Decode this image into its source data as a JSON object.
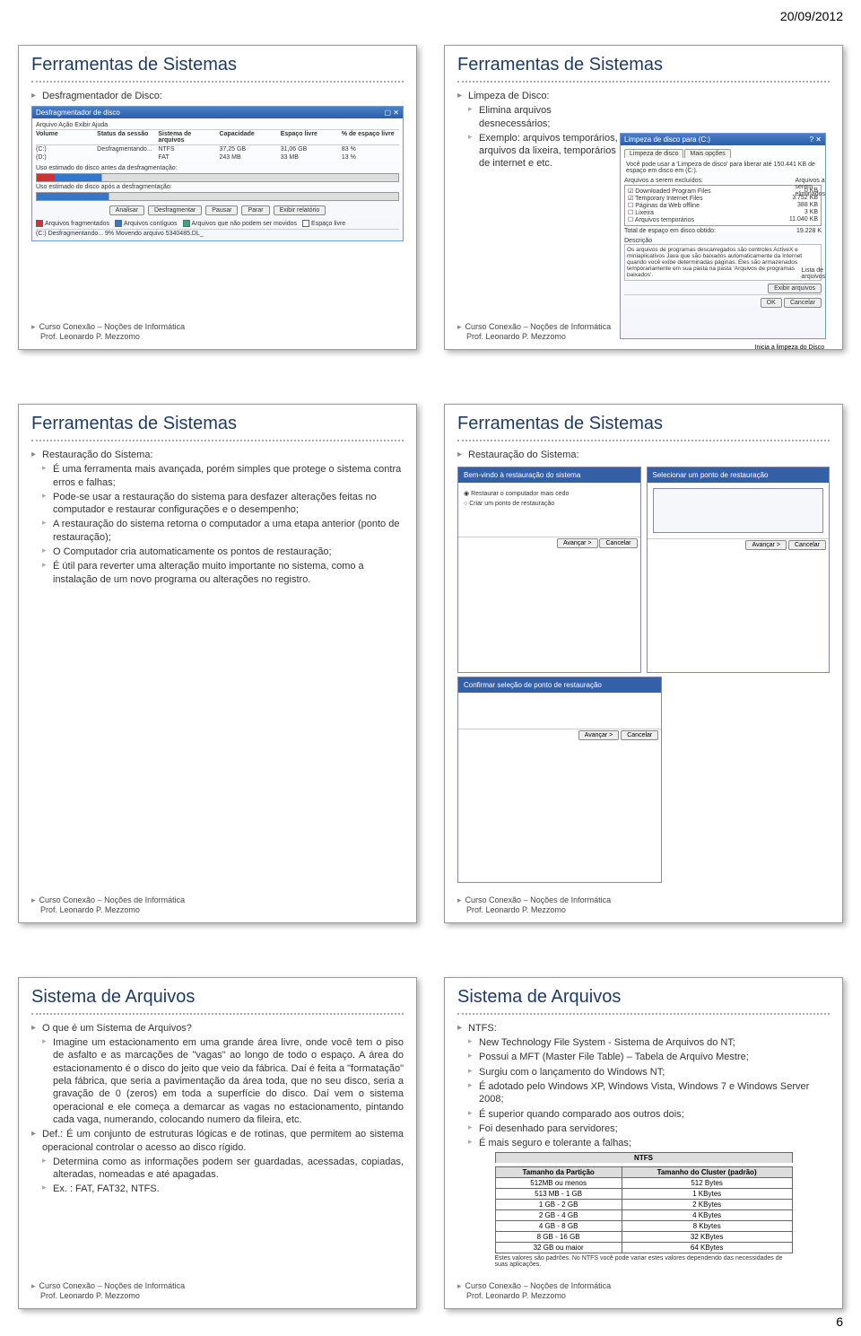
{
  "page": {
    "date": "20/09/2012",
    "number": "6"
  },
  "credit": {
    "line1": "Curso Conexão – Noções de Informática",
    "line2": "Prof. Leonardo P. Mezzomo"
  },
  "slides": {
    "s1": {
      "title": "Ferramentas de Sistemas",
      "b1": "Desfragmentador de Disco:",
      "defrag": {
        "win_title": "Desfragmentador de disco",
        "menu": "Arquivo   Ação   Exibir   Ajuda",
        "h_vol": "Volume",
        "h_status": "Status da sessão",
        "h_fs": "Sistema de arquivos",
        "h_cap": "Capacidade",
        "h_free": "Espaço livre",
        "h_pfree": "% de espaço livre",
        "r1_vol": "(C:)",
        "r1_status": "Desfragmentando...",
        "r1_fs": "NTFS",
        "r1_cap": "37,25 GB",
        "r1_free": "31,06 GB",
        "r1_pfree": "83 %",
        "r2_vol": "(D:)",
        "r2_fs": "FAT",
        "r2_cap": "243 MB",
        "r2_free": "33 MB",
        "r2_pfree": "13 %",
        "lbl_before": "Uso estimado do disco antes da desfragmentação:",
        "lbl_after": "Uso estimado do disco após a desfragmentação:",
        "btn_analyze": "Analisar",
        "btn_defrag": "Desfragmentar",
        "btn_pause": "Pausar",
        "btn_stop": "Parar",
        "btn_report": "Exibir relatório",
        "leg_frag": "Arquivos fragmentados",
        "leg_cont": "Arquivos contíguos",
        "leg_unmov": "Arquivos que não podem ser movidos",
        "leg_free": "Espaço livre",
        "status": "(C:) Desfragmentando... 9% Movendo arquivo 5340485.DL_"
      }
    },
    "s2": {
      "title": "Ferramentas de Sistemas",
      "b1": "Limpeza de Disco:",
      "b1a": "Elimina arquivos desnecessários;",
      "b1b": "Exemplo: arquivos temporários, arquivos da lixeira, temporários de internet e etc.",
      "clean": {
        "win_title": "Limpeza de disco para (C:)",
        "tab1": "Limpeza de disco",
        "tab2": "Mais opções",
        "intro": "Você pode usar a 'Limpeza de disco' para liberar até 150.441 KB de espaço em disco em (C:).",
        "lbl_files": "Arquivos a serem excluídos:",
        "i1": "Downloaded Program Files",
        "i1v": "0 KB",
        "i2": "Temporary Internet Files",
        "i2v": "3.752 KB",
        "i3": "Páginas da Web offline",
        "i3v": "388 KB",
        "i4": "Lixeira",
        "i4v": "3 KB",
        "i5": "Arquivos temporários",
        "i5v": "11.040 KB",
        "lbl_total": "Total de espaço em disco obtido:",
        "totalv": "19.228 K",
        "lbl_desc": "Descrição",
        "desc": "Os arquivos de programas descarregados são controles ActiveX e miniaplicativos Java que são baixados automaticamente da Internet quando você exibe determinadas páginas. Eles são armazenados temporariamente em sua pasta na pasta 'Arquivos de programas baixados'.",
        "btn_view": "Exibir arquivos",
        "btn_ok": "OK",
        "btn_cancel": "Cancelar",
        "annot1a": "Arquivos a",
        "annot1b": "serem",
        "annot1c": "eliminados",
        "annot2a": "Lista de",
        "annot2b": "arquivos",
        "footnote": "Inicia a limpeza do Disco"
      }
    },
    "s3": {
      "title": "Ferramentas de Sistemas",
      "b1": "Restauração do Sistema:",
      "b1a": "É uma ferramenta mais avançada, porém simples que protege o sistema contra erros e falhas;",
      "b1b": "Pode-se usar a restauração do sistema para desfazer alterações feitas no computador e restaurar configurações e o desempenho;",
      "b1c": "A restauração do sistema retorna o computador a uma etapa anterior (ponto de restauração);",
      "b1d": "O Computador cria automaticamente os pontos de restauração;",
      "b1e": "É útil para reverter uma alteração muito importante no sistema, como a instalação de um novo programa ou alterações no registro.",
      "wizard": {
        "hdr1": "Bem-vindo à restauração do sistema",
        "hdr2": "Selecionar um ponto de restauração",
        "hdr3": "Confirmar seleção de ponto de restauração",
        "opt1": "Restaurar o computador mais cedo",
        "opt2": "Criar um ponto de restauração",
        "btn_next": "Avançar >",
        "btn_cancel": "Cancelar"
      }
    },
    "s4": {
      "title": "Ferramentas de Sistemas",
      "b1": "Restauração do Sistema:"
    },
    "s5": {
      "title": "Sistema de Arquivos",
      "b1": "O que é um Sistema de Arquivos?",
      "b1a": "Imagine um estacionamento em uma grande área livre, onde você tem o piso de asfalto e as marcações de \"vagas\" ao longo de todo o espaço. A área do estacionamento é o disco do jeito que veio da fábrica. Daí é feita a \"formatação\" pela fábrica, que seria a pavimentação da área toda, que no seu disco, seria a gravação de 0 (zeros) em toda a superfície do disco. Daí vem o sistema operacional e ele começa a demarcar as vagas no estacionamento, pintando cada vaga, numerando, colocando numero da fileira, etc.",
      "b2": "Def.: É um conjunto de estruturas lógicas e de rotinas, que permitem ao sistema operacional controlar o acesso ao disco rígido.",
      "b2a": "Determina como as informações podem ser guardadas, acessadas, copiadas, alteradas, nomeadas e até apagadas.",
      "b2b": "Ex. : FAT, FAT32, NTFS."
    },
    "s6": {
      "title": "Sistema de Arquivos",
      "b1": "NTFS:",
      "b1a": "New Technology File System - Sistema de Arquivos do NT;",
      "b1b": "Possui a MFT (Master File Table) – Tabela de Arquivo Mestre;",
      "b1c": "Surgiu com o lançamento do Windows NT;",
      "b1d": "É adotado pelo Windows XP, Windows Vista, Windows 7 e Windows Server 2008;",
      "b1e": "É superior quando comparado aos outros dois;",
      "b1f": "Foi desenhado para servidores;",
      "b1g": "É mais seguro e tolerante a falhas;",
      "table": {
        "caption": "NTFS",
        "h1": "Tamanho da Partição",
        "h2": "Tamanho do Cluster (padrão)",
        "r1a": "512MB ou menos",
        "r1b": "512 Bytes",
        "r2a": "513 MB - 1 GB",
        "r2b": "1 KBytes",
        "r3a": "1 GB - 2 GB",
        "r3b": "2 KBytes",
        "r4a": "2 GB - 4 GB",
        "r4b": "4 KBytes",
        "r5a": "4 GB - 8 GB",
        "r5b": "8 Kbytes",
        "r6a": "8 GB - 16 GB",
        "r6b": "32 KBytes",
        "r7a": "32 GB ou maior",
        "r7b": "64 KBytes",
        "note": "Estes valores são padrões. No NTFS você pode variar estes valores dependendo das necessidades de suas aplicações."
      }
    }
  }
}
